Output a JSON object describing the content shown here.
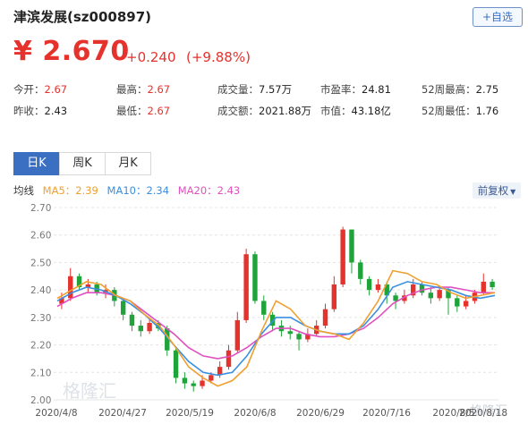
{
  "stock": {
    "title": "津滨发展(sz000897)",
    "add_label": "+自选",
    "price": "¥ 2.670",
    "change": "+0.240",
    "change_pct": "(+9.88%)"
  },
  "stats": {
    "open_label": "今开：",
    "open_val": "2.67",
    "prev_label": "昨收：",
    "prev_val": "2.43",
    "high_label": "最高：",
    "high_val": "2.67",
    "low_label": "最低：",
    "low_val": "2.67",
    "vol_label": "成交量：",
    "vol_val": "7.57万",
    "amt_label": "成交额：",
    "amt_val": "2021.88万",
    "pe_label": "市盈率：",
    "pe_val": "24.81",
    "mcap_label": "市值：",
    "mcap_val": "43.18亿",
    "h52_label": "52周最高：",
    "h52_val": "2.75",
    "l52_label": "52周最低：",
    "l52_val": "1.76"
  },
  "tabs": [
    "日K",
    "周K",
    "月K"
  ],
  "ma": {
    "label": "均线",
    "ma5": "MA5：2.39",
    "ma10": "MA10：2.34",
    "ma20": "MA20：2.43",
    "adjust": "前复权"
  },
  "colors": {
    "up": "#e5322d",
    "down": "#1fa33a",
    "ma5": "#f0a030",
    "ma10": "#3a8fe0",
    "ma20": "#e050c0"
  },
  "watermark": "格隆汇",
  "chart_data": {
    "type": "candlestick",
    "y_ticks": [
      "2.70",
      "2.60",
      "2.50",
      "2.40",
      "2.30",
      "2.20",
      "2.10",
      "2.00"
    ],
    "ylim": [
      2.0,
      2.7
    ],
    "x_ticks": [
      "2020/4/8",
      "2020/4/27",
      "2020/5/19",
      "2020/6/8",
      "2020/6/29",
      "2020/7/16",
      "2020/8/5",
      "2020/8/18"
    ],
    "ma5": [
      2.37,
      2.4,
      2.43,
      2.42,
      2.38,
      2.36,
      2.31,
      2.27,
      2.2,
      2.12,
      2.08,
      2.05,
      2.07,
      2.12,
      2.25,
      2.36,
      2.33,
      2.27,
      2.25,
      2.24,
      2.22,
      2.28,
      2.36,
      2.47,
      2.46,
      2.43,
      2.42,
      2.39,
      2.37,
      2.38,
      2.39
    ],
    "ma10": [
      2.36,
      2.39,
      2.41,
      2.4,
      2.38,
      2.35,
      2.31,
      2.26,
      2.2,
      2.14,
      2.1,
      2.09,
      2.1,
      2.16,
      2.24,
      2.3,
      2.3,
      2.27,
      2.25,
      2.24,
      2.24,
      2.27,
      2.33,
      2.41,
      2.43,
      2.42,
      2.41,
      2.4,
      2.38,
      2.37,
      2.38
    ],
    "ma20": [
      2.34,
      2.37,
      2.39,
      2.39,
      2.38,
      2.36,
      2.32,
      2.28,
      2.24,
      2.19,
      2.16,
      2.15,
      2.16,
      2.19,
      2.23,
      2.26,
      2.26,
      2.24,
      2.23,
      2.23,
      2.24,
      2.26,
      2.3,
      2.35,
      2.38,
      2.4,
      2.41,
      2.41,
      2.4,
      2.39,
      2.39
    ],
    "candles": [
      [
        2.35,
        2.37,
        2.39,
        2.33
      ],
      [
        2.37,
        2.45,
        2.48,
        2.36
      ],
      [
        2.45,
        2.41,
        2.46,
        2.4
      ],
      [
        2.41,
        2.42,
        2.44,
        2.39
      ],
      [
        2.42,
        2.39,
        2.43,
        2.38
      ],
      [
        2.39,
        2.4,
        2.42,
        2.37
      ],
      [
        2.4,
        2.36,
        2.41,
        2.34
      ],
      [
        2.36,
        2.31,
        2.37,
        2.29
      ],
      [
        2.31,
        2.27,
        2.32,
        2.25
      ],
      [
        2.27,
        2.25,
        2.29,
        2.23
      ],
      [
        2.25,
        2.28,
        2.3,
        2.24
      ],
      [
        2.28,
        2.26,
        2.29,
        2.25
      ],
      [
        2.26,
        2.18,
        2.27,
        2.16
      ],
      [
        2.18,
        2.08,
        2.19,
        2.06
      ],
      [
        2.08,
        2.06,
        2.1,
        2.04
      ],
      [
        2.06,
        2.05,
        2.07,
        2.03
      ],
      [
        2.05,
        2.07,
        2.09,
        2.04
      ],
      [
        2.07,
        2.09,
        2.1,
        2.06
      ],
      [
        2.09,
        2.12,
        2.14,
        2.08
      ],
      [
        2.12,
        2.18,
        2.2,
        2.11
      ],
      [
        2.18,
        2.29,
        2.32,
        2.17
      ],
      [
        2.29,
        2.53,
        2.55,
        2.28
      ],
      [
        2.53,
        2.36,
        2.54,
        2.35
      ],
      [
        2.36,
        2.31,
        2.38,
        2.29
      ],
      [
        2.31,
        2.27,
        2.32,
        2.25
      ],
      [
        2.27,
        2.25,
        2.29,
        2.23
      ],
      [
        2.25,
        2.24,
        2.27,
        2.22
      ],
      [
        2.24,
        2.22,
        2.25,
        2.18
      ],
      [
        2.22,
        2.24,
        2.26,
        2.21
      ],
      [
        2.24,
        2.27,
        2.29,
        2.23
      ],
      [
        2.27,
        2.33,
        2.35,
        2.26
      ],
      [
        2.33,
        2.42,
        2.45,
        2.32
      ],
      [
        2.42,
        2.62,
        2.63,
        2.41
      ],
      [
        2.62,
        2.5,
        2.61,
        2.46
      ],
      [
        2.5,
        2.44,
        2.51,
        2.42
      ],
      [
        2.44,
        2.4,
        2.45,
        2.38
      ],
      [
        2.4,
        2.42,
        2.44,
        2.39
      ],
      [
        2.42,
        2.38,
        2.43,
        2.35
      ],
      [
        2.38,
        2.36,
        2.39,
        2.33
      ],
      [
        2.36,
        2.38,
        2.4,
        2.35
      ],
      [
        2.38,
        2.42,
        2.44,
        2.37
      ],
      [
        2.42,
        2.39,
        2.43,
        2.38
      ],
      [
        2.39,
        2.37,
        2.41,
        2.35
      ],
      [
        2.37,
        2.4,
        2.41,
        2.36
      ],
      [
        2.4,
        2.37,
        2.41,
        2.31
      ],
      [
        2.37,
        2.34,
        2.38,
        2.32
      ],
      [
        2.34,
        2.36,
        2.38,
        2.33
      ],
      [
        2.36,
        2.39,
        2.4,
        2.35
      ],
      [
        2.39,
        2.43,
        2.46,
        2.38
      ],
      [
        2.43,
        2.41,
        2.44,
        2.4
      ]
    ]
  }
}
